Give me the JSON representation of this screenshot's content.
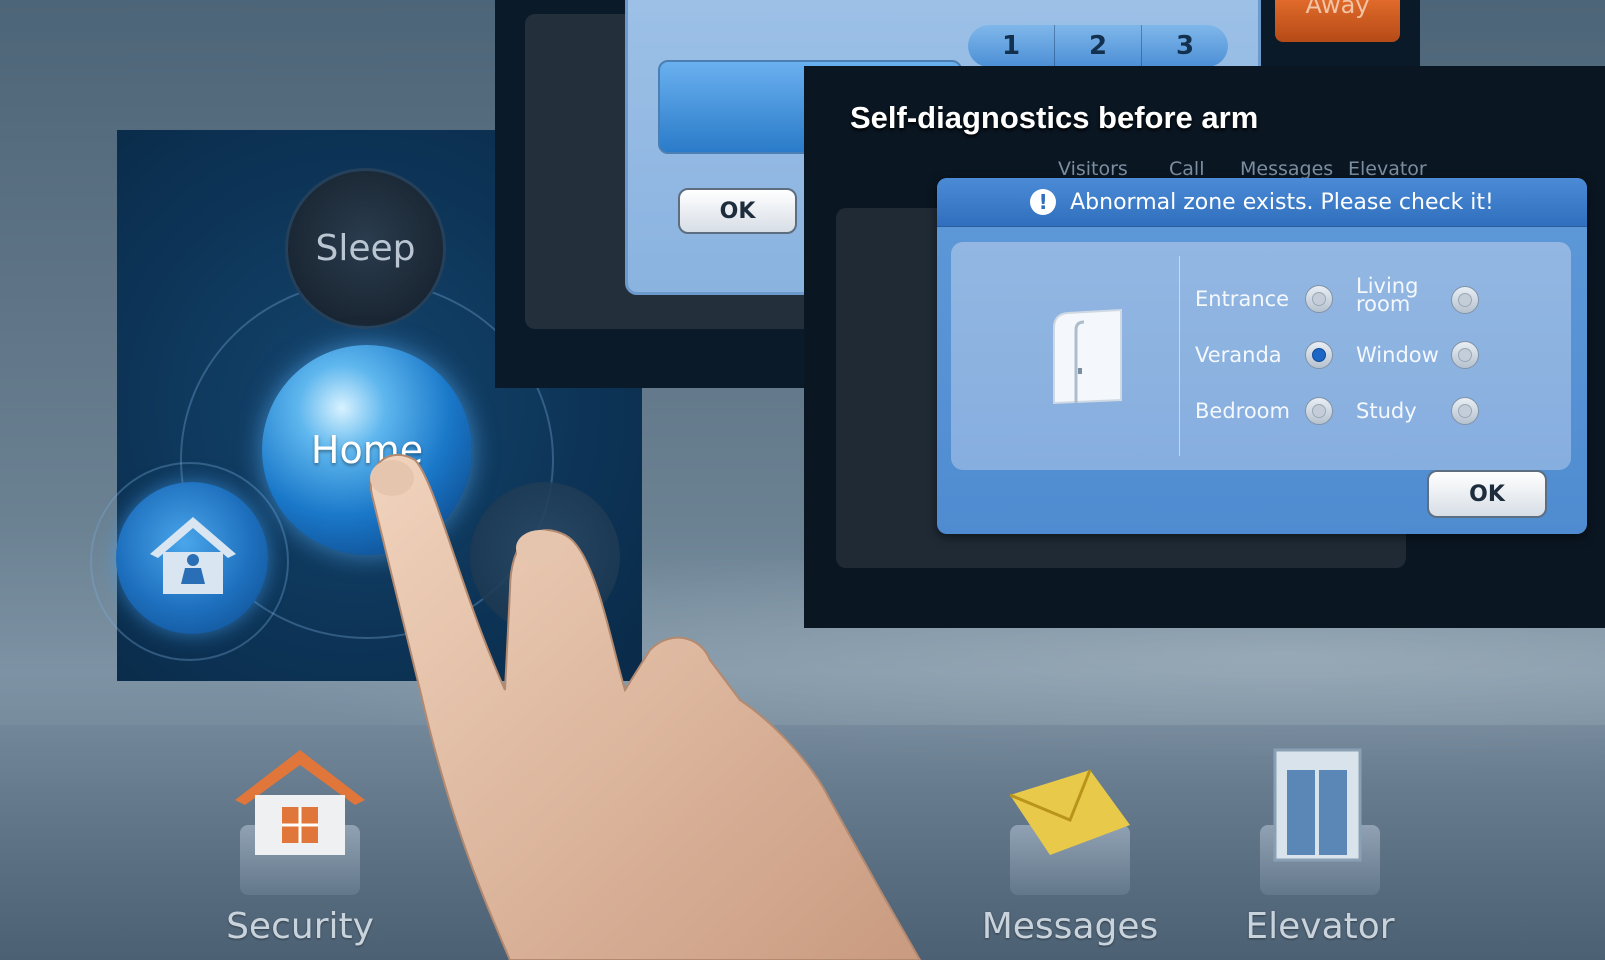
{
  "dock": {
    "items": [
      {
        "label": "Security"
      },
      {
        "label": "Messages"
      },
      {
        "label": "Elevator"
      }
    ]
  },
  "mode_panel": {
    "sleep_label": "Sleep",
    "home_label": "Home"
  },
  "back_dialog": {
    "pages": [
      "1",
      "2",
      "3"
    ],
    "ok_label": "OK",
    "away_tab": "Away"
  },
  "front_window": {
    "title": "Self-diagnostics before arm",
    "toolbar": [
      "Visitors",
      "Call",
      "Messages",
      "Elevator"
    ]
  },
  "alert": {
    "message": "Abnormal zone exists. Please check it!",
    "zones": [
      {
        "label": "Entrance",
        "checked": false
      },
      {
        "label": "Living room",
        "checked": false
      },
      {
        "label": "Veranda",
        "checked": true
      },
      {
        "label": "Window",
        "checked": false
      },
      {
        "label": "Bedroom",
        "checked": false
      },
      {
        "label": "Study",
        "checked": false
      }
    ],
    "ok_label": "OK"
  },
  "colors": {
    "dialog_blue": "#4f8bd0",
    "panel_navy": "#0d3558",
    "accent_orange": "#e06a2a"
  }
}
